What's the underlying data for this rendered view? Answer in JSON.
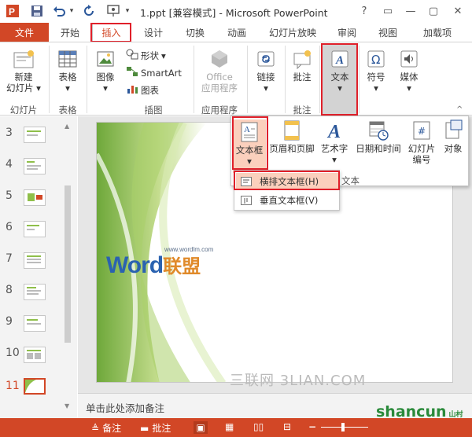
{
  "window": {
    "title": "1.ppt [兼容模式] - Microsoft PowerPoint",
    "controls": [
      "?",
      "▭",
      "—",
      "▢",
      "✕"
    ]
  },
  "tabs": {
    "file": "文件",
    "items": [
      "开始",
      "插入",
      "设计",
      "切换",
      "动画",
      "幻灯片放映",
      "审阅",
      "视图",
      "加载项"
    ],
    "active_index": 1
  },
  "ribbon": {
    "new_slide": [
      "新建",
      "幻灯片"
    ],
    "table": "表格",
    "image": "图像",
    "shapes": "形状",
    "smartart": "SmartArt",
    "chart": "图表",
    "office_apps": [
      "Office",
      "应用程序"
    ],
    "link": "链接",
    "comment": "批注",
    "text": "文本",
    "symbol": "符号",
    "media": "媒体",
    "groups": {
      "slides": "幻灯片",
      "tables": "表格",
      "illustrations": "插图",
      "apps": "应用程序",
      "comments": "批注"
    }
  },
  "text_gallery": {
    "textbox": "文本框",
    "header_footer": "页眉和页脚",
    "wordart": "艺术字",
    "datetime": "日期和时间",
    "slide_number": [
      "幻灯片",
      "编号"
    ],
    "object": "对象",
    "group_label": "文本",
    "menu": [
      "横排文本框(H)",
      "垂直文本框(V)"
    ]
  },
  "slides": {
    "numbers": [
      "3",
      "4",
      "5",
      "6",
      "7",
      "8",
      "9",
      "10",
      "11"
    ],
    "selected": "11"
  },
  "slide_content": {
    "url": "www.wordlm.com",
    "logo_word": "Word",
    "logo_cn": "联盟"
  },
  "notes": {
    "placeholder": "单击此处添加备注"
  },
  "statusbar": {
    "notes": "备注",
    "comments": "批注"
  },
  "watermark": {
    "text": "三联网 3LIAN.COM",
    "site": "shancun",
    "site_suffix": "山村"
  },
  "colors": {
    "accent": "#d24726",
    "highlight_box": "#e0202a",
    "slide_green": "#8fbf4a"
  }
}
